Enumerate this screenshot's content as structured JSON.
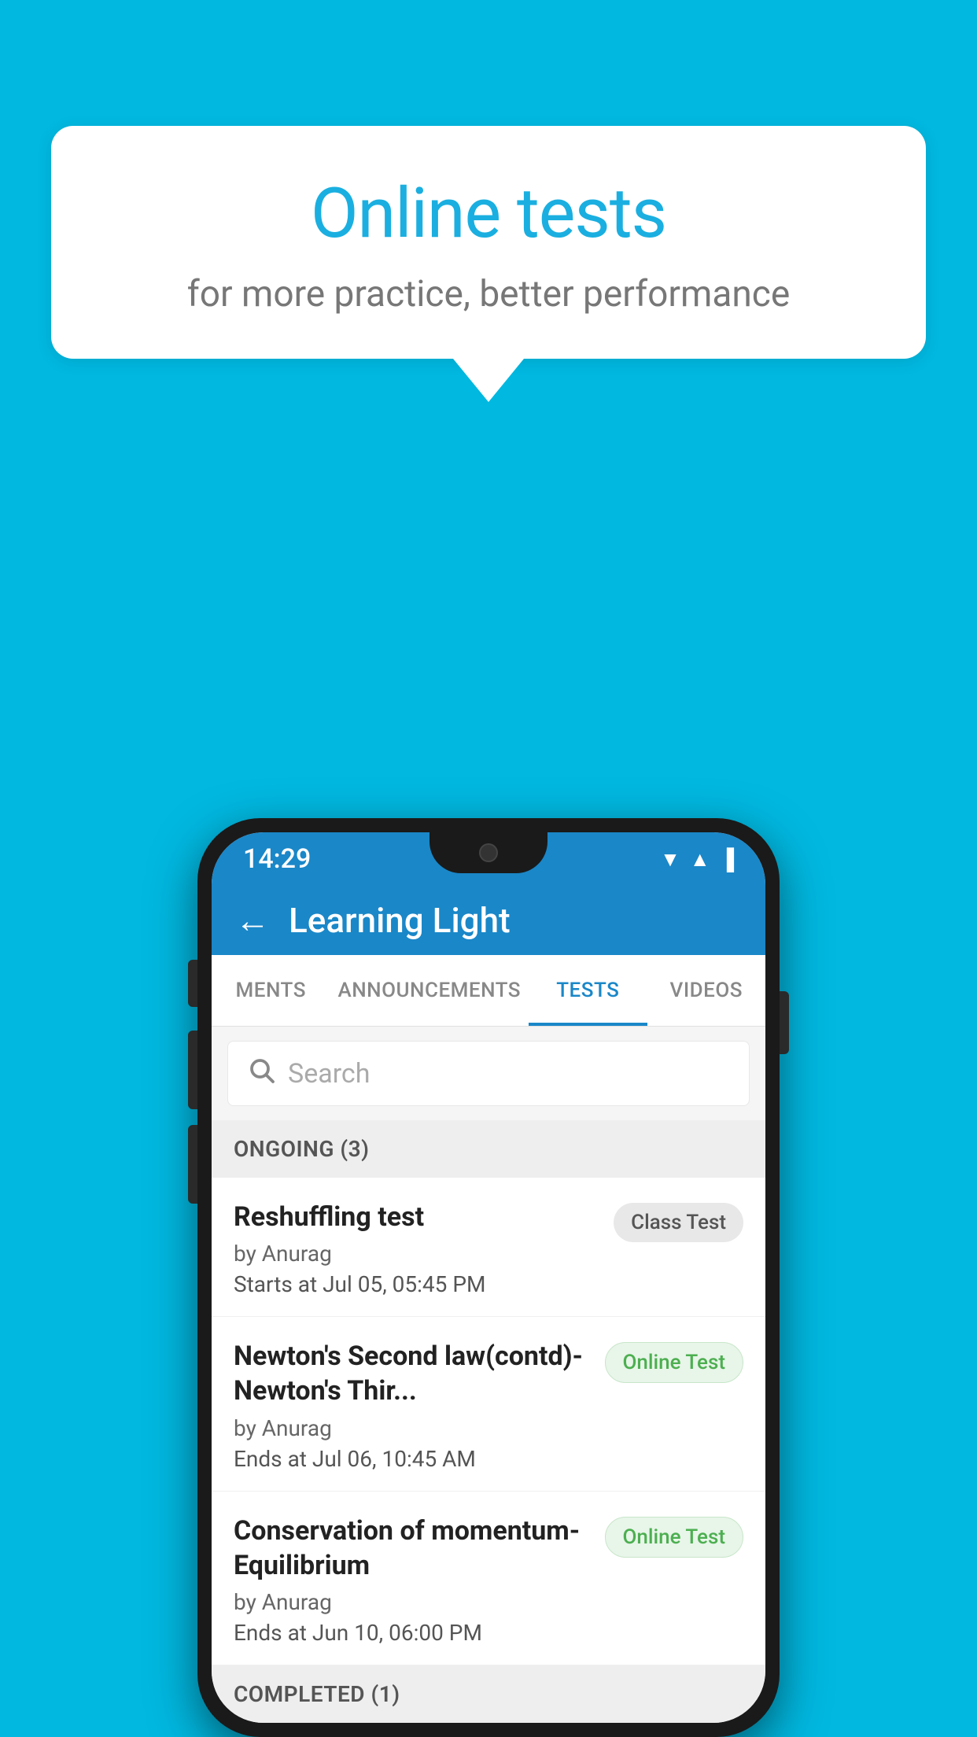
{
  "background_color": "#00b8e0",
  "speech_bubble": {
    "title": "Online tests",
    "subtitle": "for more practice, better performance"
  },
  "phone": {
    "status_bar": {
      "time": "14:29",
      "wifi": "▼",
      "signal": "▲",
      "battery": "▐"
    },
    "app_bar": {
      "back_label": "←",
      "title": "Learning Light"
    },
    "tabs": [
      {
        "label": "MENTS",
        "active": false
      },
      {
        "label": "ANNOUNCEMENTS",
        "active": false
      },
      {
        "label": "TESTS",
        "active": true
      },
      {
        "label": "VIDEOS",
        "active": false
      }
    ],
    "search": {
      "placeholder": "Search"
    },
    "section_ongoing": {
      "label": "ONGOING (3)"
    },
    "tests_ongoing": [
      {
        "name": "Reshuffling test",
        "author": "by Anurag",
        "date": "Starts at  Jul 05, 05:45 PM",
        "badge": "Class Test",
        "badge_type": "class"
      },
      {
        "name": "Newton's Second law(contd)-Newton's Thir...",
        "author": "by Anurag",
        "date": "Ends at  Jul 06, 10:45 AM",
        "badge": "Online Test",
        "badge_type": "online"
      },
      {
        "name": "Conservation of momentum-Equilibrium",
        "author": "by Anurag",
        "date": "Ends at  Jun 10, 06:00 PM",
        "badge": "Online Test",
        "badge_type": "online"
      }
    ],
    "section_completed": {
      "label": "COMPLETED (1)"
    }
  }
}
